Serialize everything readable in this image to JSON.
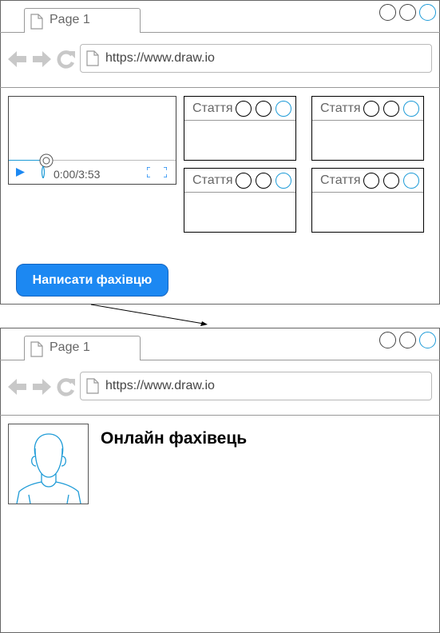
{
  "top_window": {
    "tab_label": "Page 1",
    "url": "https://www.draw.io",
    "video": {
      "time": "0:00/3:53",
      "progress_fraction": 0.0
    },
    "cards": [
      {
        "title": "Стаття"
      },
      {
        "title": "Стаття"
      },
      {
        "title": "Стаття"
      },
      {
        "title": "Стаття"
      }
    ],
    "cta_label": "Написати фахівцю"
  },
  "bottom_window": {
    "tab_label": "Page 1",
    "url": "https://www.draw.io",
    "heading": "Онлайн фахівець"
  },
  "colors": {
    "accent": "#1c88f2",
    "icon_blue": "#1e9bd7",
    "nav_gray": "#c8c8c8"
  },
  "icons": [
    "page-icon",
    "back-arrow-icon",
    "forward-arrow-icon",
    "refresh-icon",
    "play-icon",
    "volume-icon",
    "fullscreen-icon",
    "user-avatar-icon"
  ]
}
